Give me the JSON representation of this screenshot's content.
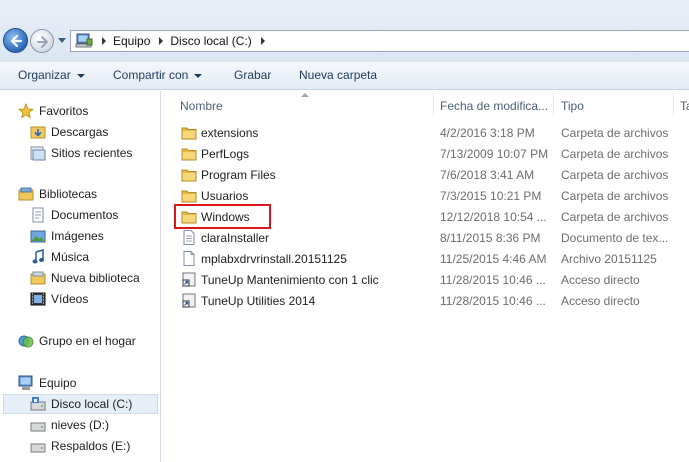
{
  "address": {
    "crumbs": [
      "Equipo",
      "Disco local (C:)"
    ]
  },
  "toolbar": {
    "organize_label": "Organizar",
    "share_label": "Compartir con",
    "burn_label": "Grabar",
    "new_folder_label": "Nueva carpeta"
  },
  "nav": {
    "favorites": {
      "label": "Favoritos",
      "items": [
        "Descargas",
        "Sitios recientes"
      ]
    },
    "libraries": {
      "label": "Bibliotecas",
      "items": [
        "Documentos",
        "Imágenes",
        "Música",
        "Nueva biblioteca",
        "Vídeos"
      ]
    },
    "homegroup": {
      "label": "Grupo en el hogar"
    },
    "computer": {
      "label": "Equipo",
      "items": [
        "Disco local (C:)",
        "nieves (D:)",
        "Respaldos (E:)"
      ]
    }
  },
  "columns": {
    "name": "Nombre",
    "date": "Fecha de modifica...",
    "type": "Tipo",
    "size": "Ta"
  },
  "files": [
    {
      "name": "extensions",
      "date": "4/2/2016 3:18 PM",
      "type": "Carpeta de archivos",
      "icon": "folder-icon"
    },
    {
      "name": "PerfLogs",
      "date": "7/13/2009 10:07 PM",
      "type": "Carpeta de archivos",
      "icon": "folder-icon"
    },
    {
      "name": "Program Files",
      "date": "7/6/2018 3:41 AM",
      "type": "Carpeta de archivos",
      "icon": "folder-icon"
    },
    {
      "name": "Usuarios",
      "date": "7/3/2015 10:21 PM",
      "type": "Carpeta de archivos",
      "icon": "folder-icon"
    },
    {
      "name": "Windows",
      "date": "12/12/2018 10:54 ...",
      "type": "Carpeta de archivos",
      "icon": "folder-icon"
    },
    {
      "name": "claraInstaller",
      "date": "8/11/2015 8:36 PM",
      "type": "Documento de tex...",
      "icon": "text-file-icon"
    },
    {
      "name": "mplabxdrvrinstall.20151125",
      "date": "11/25/2015 4:46 AM",
      "type": "Archivo 20151125",
      "icon": "file-icon"
    },
    {
      "name": "TuneUp Mantenimiento con 1 clic",
      "date": "11/28/2015 10:46 ...",
      "type": "Acceso directo",
      "icon": "shortcut-icon"
    },
    {
      "name": "TuneUp Utilities 2014",
      "date": "11/28/2015 10:46 ...",
      "type": "Acceso directo",
      "icon": "shortcut-icon"
    }
  ],
  "colors": {
    "highlight": "#d9161c",
    "folder": "#f0c95a",
    "toolbar_text": "#1e3a5f"
  }
}
